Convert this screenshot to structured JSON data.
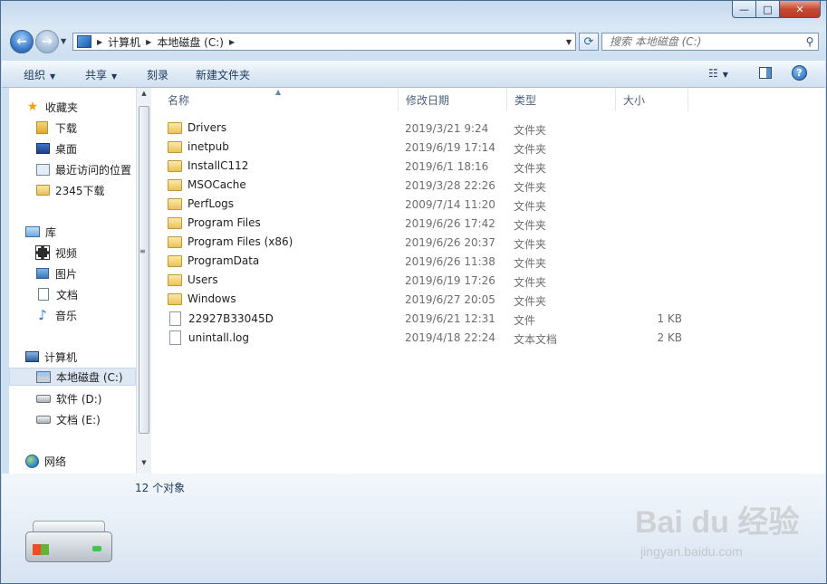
{
  "window": {
    "min_symbol": "—",
    "max_symbol": "□",
    "close_symbol": "✕"
  },
  "nav": {
    "breadcrumb": [
      "计算机",
      "本地磁盘 (C:)"
    ],
    "search_placeholder": "搜索 本地磁盘 (C:)"
  },
  "toolbar": {
    "organize": "组织",
    "share": "共享",
    "burn": "刻录",
    "new_folder": "新建文件夹"
  },
  "sidebar": {
    "favorites": {
      "label": "收藏夹",
      "items": [
        "下载",
        "桌面",
        "最近访问的位置",
        "2345下载"
      ]
    },
    "libraries": {
      "label": "库",
      "items": [
        "视频",
        "图片",
        "文档",
        "音乐"
      ]
    },
    "computer": {
      "label": "计算机",
      "items": [
        "本地磁盘 (C:)",
        "软件 (D:)",
        "文档 (E:)"
      ],
      "selected": "本地磁盘 (C:)"
    },
    "network": {
      "label": "网络"
    }
  },
  "list": {
    "columns": [
      "名称",
      "修改日期",
      "类型",
      "大小"
    ],
    "rows": [
      {
        "name": "Drivers",
        "date": "2019/3/21 9:24",
        "type": "文件夹",
        "size": ""
      },
      {
        "name": "inetpub",
        "date": "2019/6/19 17:14",
        "type": "文件夹",
        "size": ""
      },
      {
        "name": "InstallC112",
        "date": "2019/6/1 18:16",
        "type": "文件夹",
        "size": ""
      },
      {
        "name": "MSOCache",
        "date": "2019/3/28 22:26",
        "type": "文件夹",
        "size": ""
      },
      {
        "name": "PerfLogs",
        "date": "2009/7/14 11:20",
        "type": "文件夹",
        "size": ""
      },
      {
        "name": "Program Files",
        "date": "2019/6/26 17:42",
        "type": "文件夹",
        "size": ""
      },
      {
        "name": "Program Files (x86)",
        "date": "2019/6/26 20:37",
        "type": "文件夹",
        "size": ""
      },
      {
        "name": "ProgramData",
        "date": "2019/6/26 11:38",
        "type": "文件夹",
        "size": ""
      },
      {
        "name": "Users",
        "date": "2019/6/19 17:26",
        "type": "文件夹",
        "size": ""
      },
      {
        "name": "Windows",
        "date": "2019/6/27 20:05",
        "type": "文件夹",
        "size": ""
      },
      {
        "name": "22927B33045D",
        "date": "2019/6/21 12:31",
        "type": "文件",
        "size": "1 KB"
      },
      {
        "name": "unintall.log",
        "date": "2019/4/18 22:24",
        "type": "文本文档",
        "size": "2 KB"
      }
    ]
  },
  "details": {
    "count": "12 个对象"
  },
  "watermark": {
    "brand": "Bai du 经验",
    "url": "jingyan.baidu.com"
  }
}
